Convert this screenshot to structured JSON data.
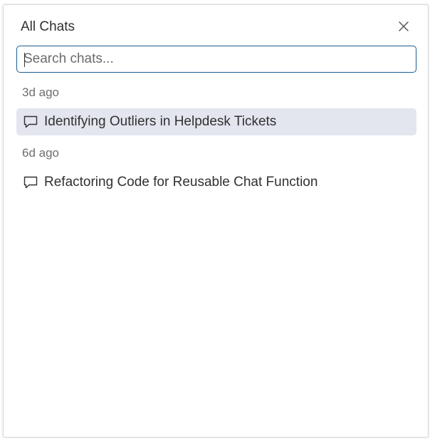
{
  "panel": {
    "title": "All Chats",
    "close_icon": "close-icon"
  },
  "search": {
    "placeholder": "Search chats...",
    "value": ""
  },
  "groups": [
    {
      "label": "3d ago",
      "items": [
        {
          "label": "Identifying Outliers in Helpdesk Tickets",
          "icon": "chat-bubble-icon",
          "selected": true
        }
      ]
    },
    {
      "label": "6d ago",
      "items": [
        {
          "label": "Refactoring Code for Reusable Chat Function",
          "icon": "chat-bubble-icon",
          "selected": false
        }
      ]
    }
  ],
  "colors": {
    "accent_border": "#1b5e91",
    "selected_background": "#e3e5ef",
    "text": "#323130",
    "muted_text": "#6e6e6e"
  }
}
